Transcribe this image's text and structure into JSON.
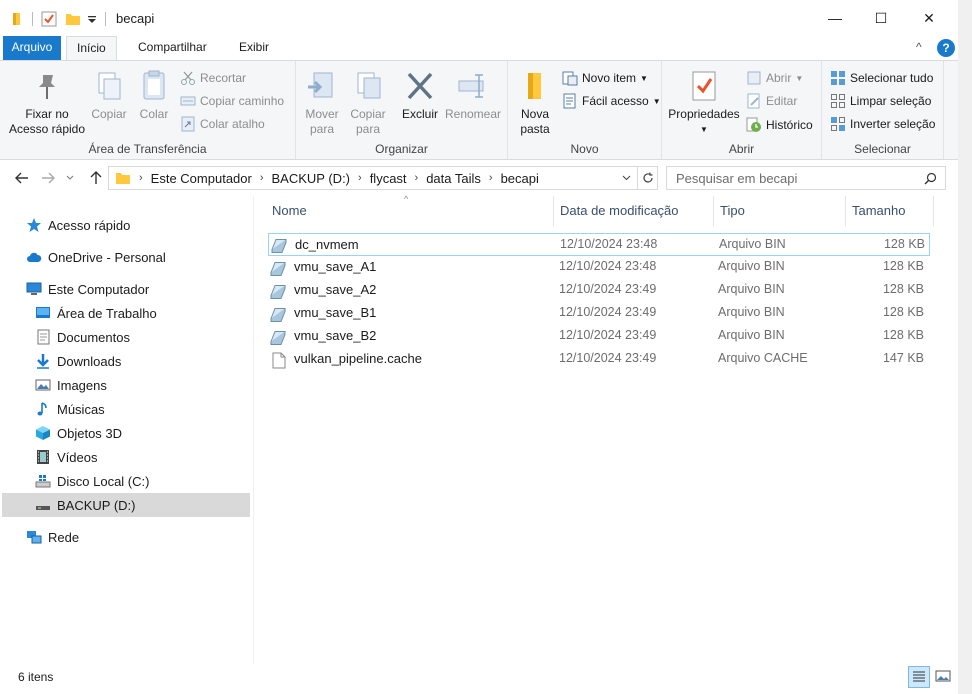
{
  "window": {
    "title": "becapi",
    "minimize_glyph": "—",
    "maximize_glyph": "☐",
    "close_glyph": "✕"
  },
  "ribbon_tabs": {
    "file": "Arquivo",
    "home": "Início",
    "share": "Compartilhar",
    "view": "Exibir",
    "collapse_glyph": "^",
    "help_glyph": "?"
  },
  "clipboard": {
    "pin": "Fixar no Acesso rápido",
    "copy": "Copiar",
    "paste": "Colar",
    "cut": "Recortar",
    "copy_path": "Copiar caminho",
    "paste_shortcut": "Colar atalho",
    "label": "Área de Transferência"
  },
  "organize": {
    "move": "Mover para",
    "copy_to": "Copiar para",
    "delete": "Excluir",
    "rename": "Renomear",
    "label": "Organizar"
  },
  "new_group": {
    "new_folder": "Nova pasta",
    "new_item": "Novo item",
    "easy_access": "Fácil acesso",
    "label": "Novo"
  },
  "open_group": {
    "properties": "Propriedades",
    "open": "Abrir",
    "edit": "Editar",
    "history": "Histórico",
    "label": "Abrir"
  },
  "select_group": {
    "select_all": "Selecionar tudo",
    "select_none": "Limpar seleção",
    "invert": "Inverter seleção",
    "label": "Selecionar"
  },
  "address": {
    "crumbs": [
      "Este Computador",
      "BACKUP (D:)",
      "flycast",
      "data Tails",
      "becapi"
    ],
    "search_placeholder": "Pesquisar em becapi"
  },
  "nav": {
    "quick_access": "Acesso rápido",
    "onedrive": "OneDrive - Personal",
    "this_pc": "Este Computador",
    "desktop": "Área de Trabalho",
    "documents": "Documentos",
    "downloads": "Downloads",
    "pictures": "Imagens",
    "music": "Músicas",
    "objects3d": "Objetos 3D",
    "videos": "Vídeos",
    "local_disk": "Disco Local (C:)",
    "backup": "BACKUP (D:)",
    "network": "Rede"
  },
  "columns": {
    "name": "Nome",
    "modified": "Data de modificação",
    "type": "Tipo",
    "size": "Tamanho"
  },
  "files": [
    {
      "name": "dc_nvmem",
      "modified": "12/10/2024 23:48",
      "type": "Arquivo BIN",
      "size": "128 KB"
    },
    {
      "name": "vmu_save_A1",
      "modified": "12/10/2024 23:48",
      "type": "Arquivo BIN",
      "size": "128 KB"
    },
    {
      "name": "vmu_save_A2",
      "modified": "12/10/2024 23:49",
      "type": "Arquivo BIN",
      "size": "128 KB"
    },
    {
      "name": "vmu_save_B1",
      "modified": "12/10/2024 23:49",
      "type": "Arquivo BIN",
      "size": "128 KB"
    },
    {
      "name": "vmu_save_B2",
      "modified": "12/10/2024 23:49",
      "type": "Arquivo BIN",
      "size": "128 KB"
    },
    {
      "name": "vulkan_pipeline.cache",
      "modified": "12/10/2024 23:49",
      "type": "Arquivo CACHE",
      "size": "147 KB"
    }
  ],
  "status": {
    "count": "6 itens"
  },
  "colors": {
    "file_tab": "#1979ca",
    "ribbon_bg": "#f5f6f7",
    "selection": "#d9d9d9",
    "row_focus": "#99d1ff",
    "folder": "#ffc83d"
  }
}
